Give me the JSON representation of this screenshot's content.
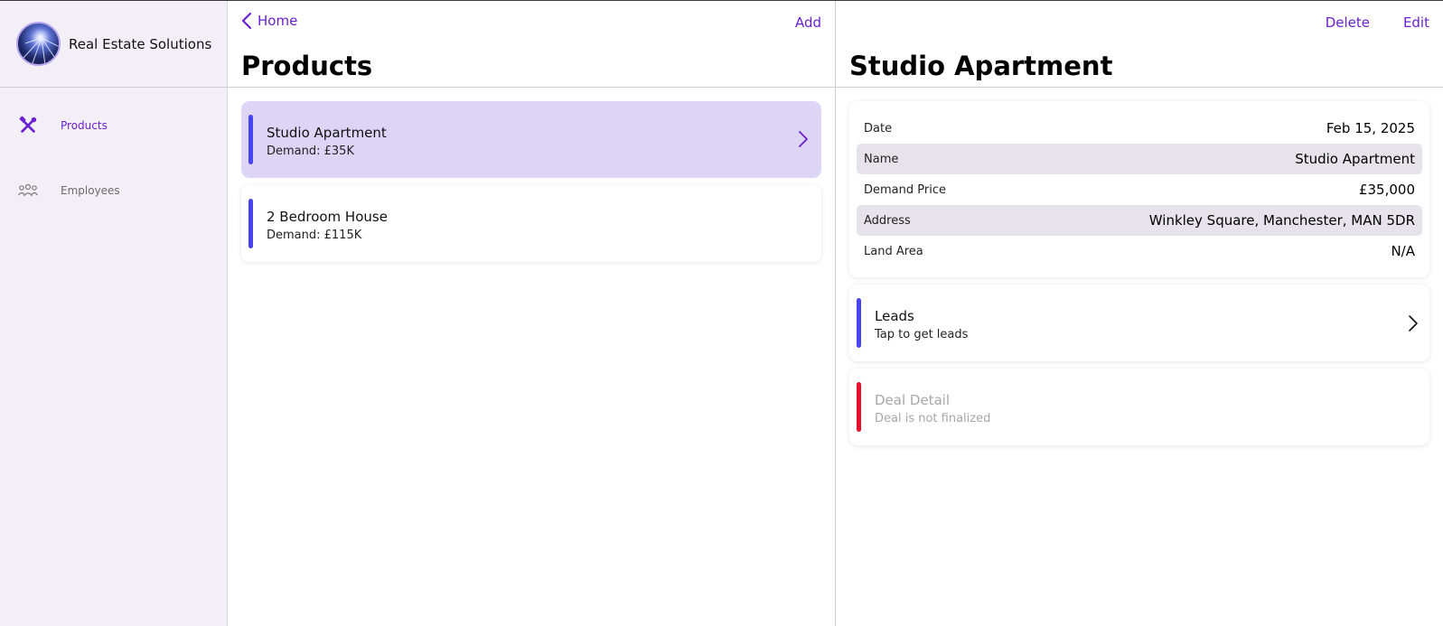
{
  "app": {
    "brand_name": "Real Estate Solutions",
    "accent_color": "#6a1fd0",
    "bar_blue": "#4a44f0",
    "bar_red": "#e8102a"
  },
  "sidebar": {
    "items": [
      {
        "label": "Products",
        "icon": "hammer-wrench-icon",
        "active": true
      },
      {
        "label": "Employees",
        "icon": "people-group-icon",
        "active": false
      }
    ]
  },
  "list_pane": {
    "back_label": "Home",
    "add_label": "Add",
    "title": "Products",
    "items": [
      {
        "title": "Studio Apartment",
        "subtitle": "Demand: £35K",
        "selected": true
      },
      {
        "title": "2 Bedroom House",
        "subtitle": "Demand: £115K",
        "selected": false
      }
    ]
  },
  "detail_pane": {
    "delete_label": "Delete",
    "edit_label": "Edit",
    "title": "Studio Apartment",
    "fields": [
      {
        "key": "Date",
        "value": "Feb 15, 2025"
      },
      {
        "key": "Name",
        "value": "Studio Apartment"
      },
      {
        "key": "Demand Price",
        "value": "£35,000"
      },
      {
        "key": "Address",
        "value": "Winkley Square, Manchester, MAN 5DR"
      },
      {
        "key": "Land Area",
        "value": "N/A"
      }
    ],
    "leads": {
      "title": "Leads",
      "subtitle": "Tap to get leads"
    },
    "deal": {
      "title": "Deal Detail",
      "subtitle": "Deal is not finalized"
    }
  }
}
